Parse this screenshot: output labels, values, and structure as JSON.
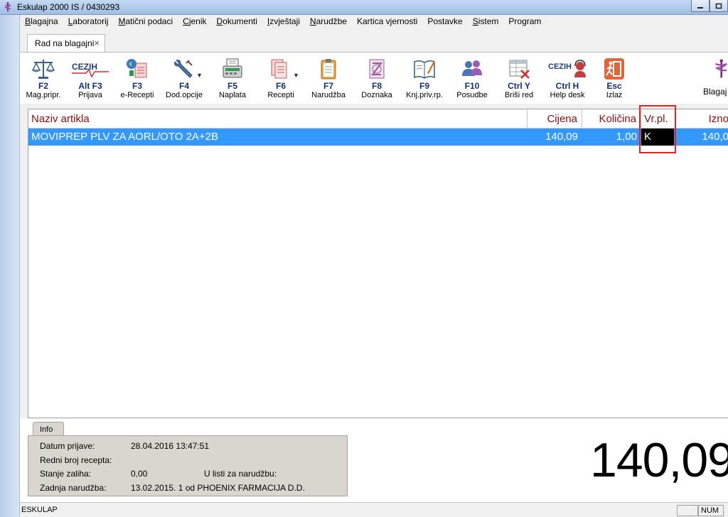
{
  "window": {
    "title": "Eskulap 2000  IS / 0430293"
  },
  "menu": [
    {
      "label": "Blagajna",
      "ul": "B"
    },
    {
      "label": "Laboratorij",
      "ul": "L"
    },
    {
      "label": "Matični podaci",
      "ul": "M"
    },
    {
      "label": "Cjenik",
      "ul": "C"
    },
    {
      "label": "Dokumenti",
      "ul": "D"
    },
    {
      "label": "Izvještaji",
      "ul": "I"
    },
    {
      "label": "Narudžbe",
      "ul": "N"
    },
    {
      "label": "Kartica vjernosti",
      "ul": ""
    },
    {
      "label": "Postavke",
      "ul": ""
    },
    {
      "label": "Sistem",
      "ul": "S"
    },
    {
      "label": "Program",
      "ul": ""
    }
  ],
  "tab": {
    "label": "Rad na blagajni",
    "close": "×"
  },
  "toolbar": [
    {
      "key": "F2",
      "label": "Mag.pripr.",
      "icon": "scales-icon"
    },
    {
      "key": "Alt F3",
      "label": "Prijava",
      "icon": "cezih-login-icon"
    },
    {
      "key": "F3",
      "label": "e-Recepti",
      "icon": "e-recipe-icon"
    },
    {
      "key": "F4",
      "label": "Dod.opcije",
      "icon": "wrench-icon"
    },
    {
      "key": "F5",
      "label": "Naplata",
      "icon": "cash-register-icon"
    },
    {
      "key": "F6",
      "label": "Recepti",
      "icon": "recipes-icon"
    },
    {
      "key": "F7",
      "label": "Narudžba",
      "icon": "clipboard-icon"
    },
    {
      "key": "F8",
      "label": "Doznaka",
      "icon": "remittance-icon"
    },
    {
      "key": "F9",
      "label": "Knj.priv.rp.",
      "icon": "book-icon"
    },
    {
      "key": "F10",
      "label": "Posudbe",
      "icon": "people-icon"
    },
    {
      "key": "Ctrl Y",
      "label": "Briši red",
      "icon": "delete-row-icon"
    },
    {
      "key": "Ctrl H",
      "label": "Help desk",
      "icon": "helpdesk-icon"
    },
    {
      "key": "Esc",
      "label": "Izlaz",
      "icon": "exit-icon"
    },
    {
      "key": "",
      "label": "Blagaj",
      "icon": "caduceus-icon"
    }
  ],
  "cezih_text": "CEZIH",
  "grid": {
    "columns": {
      "naziv": "Naziv artikla",
      "cijena": "Cijena",
      "kolicina": "Količina",
      "vrpl": "Vr.pl.",
      "iznos": "Izno"
    },
    "rows": [
      {
        "naziv": "MOVIPREP PLV ZA AORL/OTO 2A+2B",
        "cijena": "140,09",
        "kolicina": "1,00",
        "vrpl": "K",
        "iznos": "140,0"
      }
    ]
  },
  "info": {
    "tab": "Info",
    "datum_label": "Datum prijave:",
    "datum_value": "28.04.2016 13:47:51",
    "recept_label": "Redni broj recepta:",
    "recept_value": "",
    "stanje_label": "Stanje zaliha:",
    "stanje_value": "0,00",
    "lista_label": "U listi za narudžbu:",
    "narudzba_label": "Zadnja narudžba:",
    "narudzba_value": "13.02.2015. 1  od  PHOENIX FARMACIJA D.D."
  },
  "total": "140,09",
  "status": {
    "left": "ESKULAP",
    "num": "NUM"
  },
  "colors": {
    "row_selected": "#3399ff",
    "header_text": "#8b0d0d",
    "highlight": "#e02424",
    "key_text": "#10307a"
  }
}
